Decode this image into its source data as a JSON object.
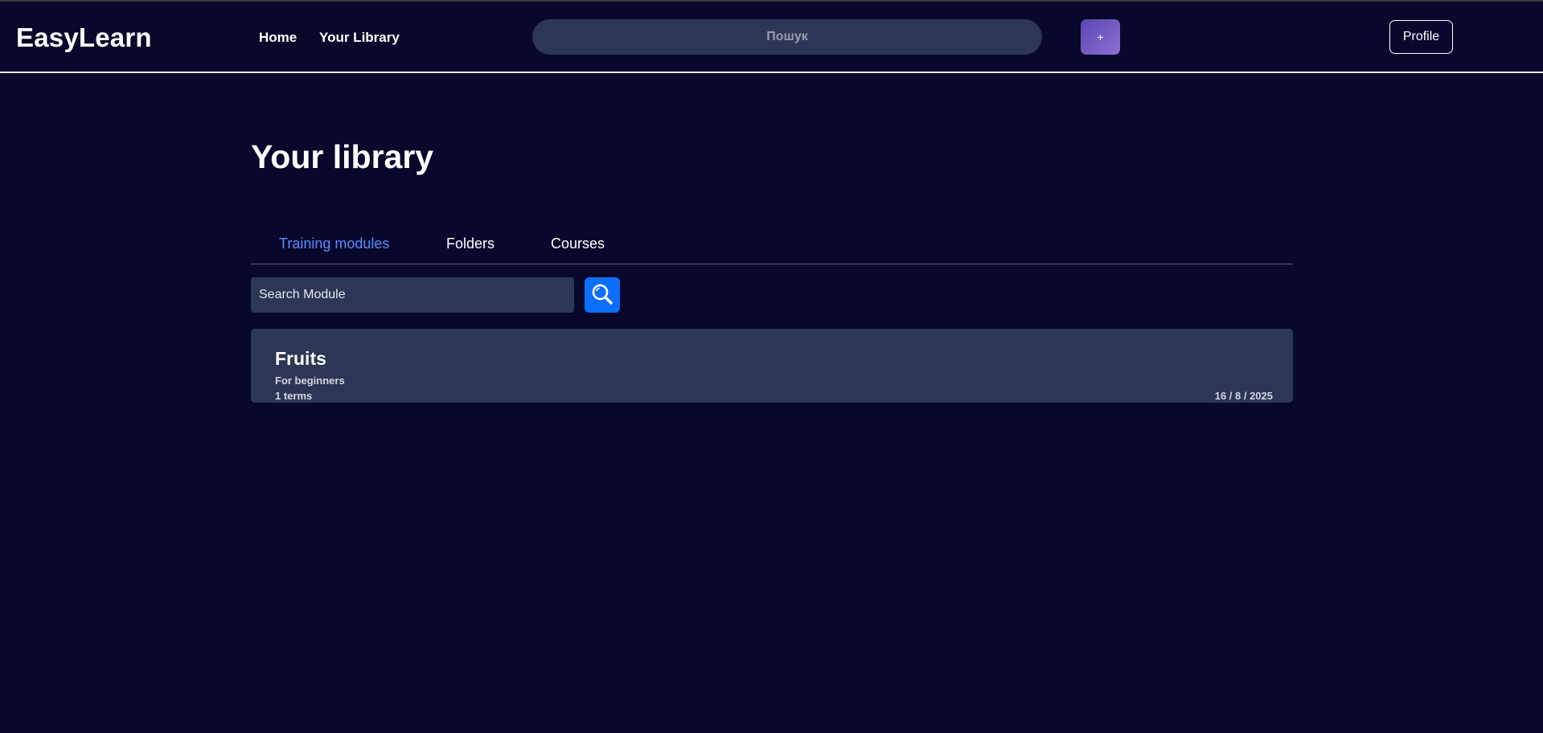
{
  "header": {
    "logo": "EasyLearn",
    "nav": [
      {
        "label": "Home"
      },
      {
        "label": "Your Library"
      }
    ],
    "search_placeholder": "Пошук",
    "add_label": "+",
    "profile_label": "Profile"
  },
  "page": {
    "title": "Your library"
  },
  "tabs": [
    {
      "label": "Training modules",
      "active": true
    },
    {
      "label": "Folders",
      "active": false
    },
    {
      "label": "Courses",
      "active": false
    }
  ],
  "module_search": {
    "placeholder": "Search Module",
    "button_icon": "search-icon"
  },
  "modules": [
    {
      "title": "Fruits",
      "description": "For beginners",
      "terms": "1 terms",
      "date": "16 / 8 / 2025"
    }
  ],
  "colors": {
    "background": "#08082c",
    "surface": "#2d3654",
    "active_tab": "#5b8bff",
    "search_button": "#0d6efd",
    "add_button_gradient": [
      "#5b47b3",
      "#8c6fd6"
    ]
  }
}
